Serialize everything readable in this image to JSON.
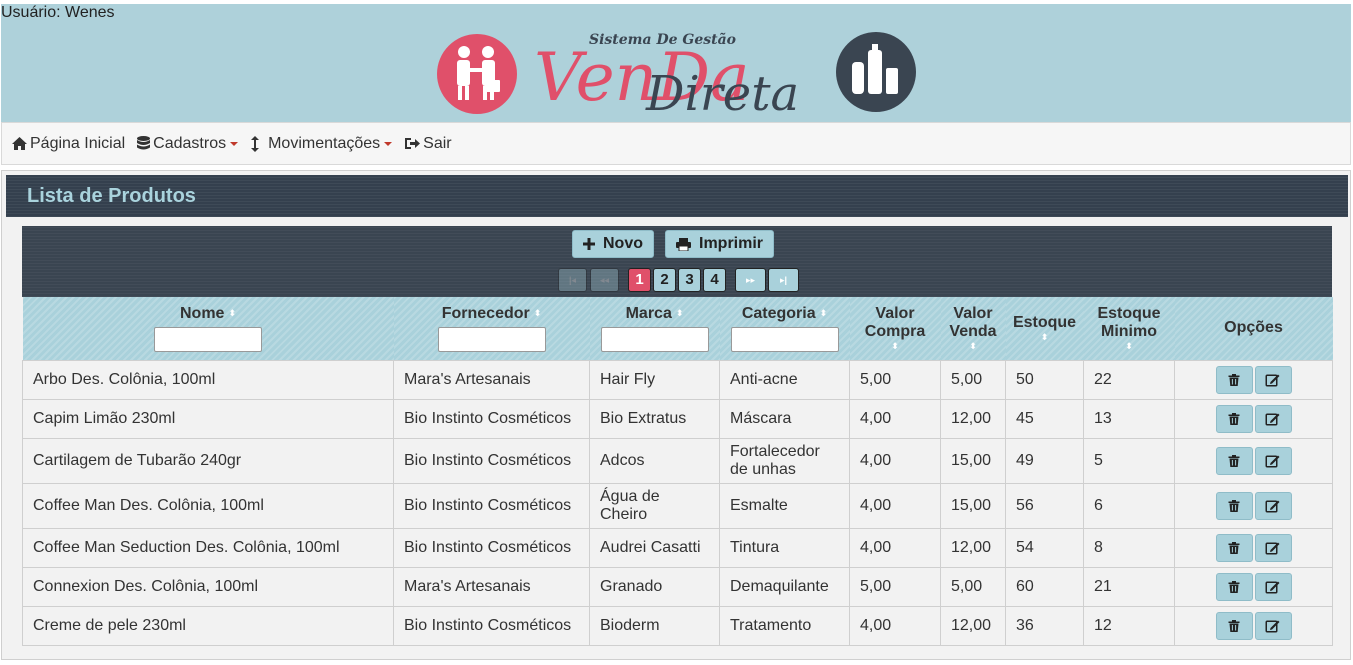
{
  "user": {
    "label": "Usuário: Wenes"
  },
  "logo": {
    "tagline": "Sistema De Gestão",
    "word1": "VenDa",
    "word2": "Direta"
  },
  "nav": {
    "items": [
      {
        "label": "Página Inicial",
        "icon": "home-icon"
      },
      {
        "label": "Cadastros",
        "icon": "database-icon",
        "dropdown": true
      },
      {
        "label": "Movimentações",
        "icon": "vertical-arrows-icon",
        "dropdown": true
      },
      {
        "label": "Sair",
        "icon": "sign-out-icon"
      }
    ]
  },
  "panel": {
    "title": "Lista de Produtos"
  },
  "toolbar": {
    "new_label": "Novo",
    "print_label": "Imprimir"
  },
  "pager": {
    "pages": [
      "1",
      "2",
      "3",
      "4"
    ],
    "active": "1",
    "first": "|◂",
    "prev": "◂◂",
    "next": "▸▸",
    "last": "▸|"
  },
  "table": {
    "headers": {
      "nome": "Nome",
      "fornecedor": "Fornecedor",
      "marca": "Marca",
      "categoria": "Categoria",
      "valor_compra_1": "Valor",
      "valor_compra_2": "Compra",
      "valor_venda_1": "Valor",
      "valor_venda_2": "Venda",
      "estoque": "Estoque",
      "estoque_min_1": "Estoque",
      "estoque_min_2": "Minimo",
      "opcoes": "Opções"
    },
    "rows": [
      {
        "nome": "Arbo Des. Colônia, 100ml",
        "fornecedor": "Mara's Artesanais",
        "marca": "Hair Fly",
        "categoria": "Anti-acne",
        "valor_compra": "5,00",
        "valor_venda": "5,00",
        "estoque": "50",
        "estoque_minimo": "22"
      },
      {
        "nome": "Capim Limão 230ml",
        "fornecedor": "Bio Instinto Cosméticos",
        "marca": "Bio Extratus",
        "categoria": "Máscara",
        "valor_compra": "4,00",
        "valor_venda": "12,00",
        "estoque": "45",
        "estoque_minimo": "13"
      },
      {
        "nome": "Cartilagem de Tubarão 240gr",
        "fornecedor": "Bio Instinto Cosméticos",
        "marca": "Adcos",
        "categoria": "Fortalecedor de unhas",
        "valor_compra": "4,00",
        "valor_venda": "15,00",
        "estoque": "49",
        "estoque_minimo": "5"
      },
      {
        "nome": "Coffee Man Des. Colônia, 100ml",
        "fornecedor": "Bio Instinto Cosméticos",
        "marca": "Água de Cheiro",
        "categoria": "Esmalte",
        "valor_compra": "4,00",
        "valor_venda": "15,00",
        "estoque": "56",
        "estoque_minimo": "6"
      },
      {
        "nome": "Coffee Man Seduction Des. Colônia, 100ml",
        "fornecedor": "Bio Instinto Cosméticos",
        "marca": "Audrei Casatti",
        "categoria": "Tintura",
        "valor_compra": "4,00",
        "valor_venda": "12,00",
        "estoque": "54",
        "estoque_minimo": "8"
      },
      {
        "nome": "Connexion Des. Colônia, 100ml",
        "fornecedor": "Mara's Artesanais",
        "marca": "Granado",
        "categoria": "Demaquilante",
        "valor_compra": "5,00",
        "valor_venda": "5,00",
        "estoque": "60",
        "estoque_minimo": "21"
      },
      {
        "nome": "Creme de pele 230ml",
        "fornecedor": "Bio Instinto Cosméticos",
        "marca": "Bioderm",
        "categoria": "Tratamento",
        "valor_compra": "4,00",
        "valor_venda": "12,00",
        "estoque": "36",
        "estoque_minimo": "12"
      }
    ]
  },
  "colors": {
    "header_bg": "#aed1da",
    "panel_title_bg": "#34404e",
    "panel_title_fg": "#a9d3dd",
    "button_bg": "#a9d1db",
    "active_page": "#e0506a",
    "logo_red": "#e0506a",
    "logo_dark": "#3a4551"
  }
}
